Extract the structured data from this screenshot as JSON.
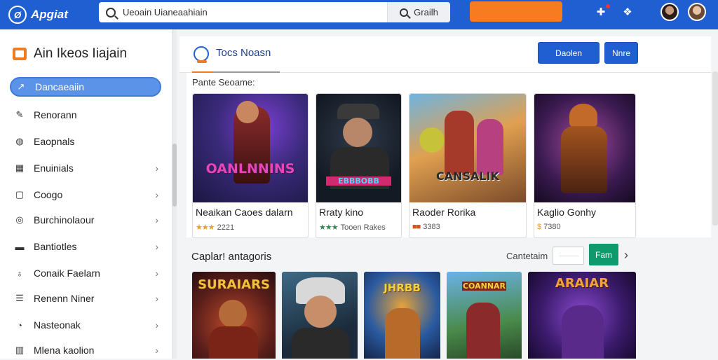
{
  "topbar": {
    "logo_text": "Apgiat",
    "search_value": "Ueoain Uianeaahiain",
    "search_button": "Grailh"
  },
  "sidebar": {
    "header": "Ain Ikeos Iiajain",
    "items": [
      {
        "label": "Dancaeaiin",
        "icon": "compass-icon",
        "active": true,
        "chevron": false
      },
      {
        "label": "Renorann",
        "icon": "wrench-icon",
        "active": false,
        "chevron": false
      },
      {
        "label": "Eaopnals",
        "icon": "gamepad-icon",
        "active": false,
        "chevron": false
      },
      {
        "label": "Enuinials",
        "icon": "grid-icon",
        "active": false,
        "chevron": true
      },
      {
        "label": "Coogo",
        "icon": "square-icon",
        "active": false,
        "chevron": true
      },
      {
        "label": "Burchinolaour",
        "icon": "target-icon",
        "active": false,
        "chevron": true
      },
      {
        "label": "Bantiotles",
        "icon": "folder-icon",
        "active": false,
        "chevron": true
      },
      {
        "label": "Conaik Faelarn",
        "icon": "trophy-icon",
        "active": false,
        "chevron": true
      },
      {
        "label": "Renenn Niner",
        "icon": "list-icon",
        "active": false,
        "chevron": true
      },
      {
        "label": "Nasteonak",
        "icon": "clock-icon",
        "active": false,
        "chevron": true
      },
      {
        "label": "Mlena kaolion",
        "icon": "bars-icon",
        "active": false,
        "chevron": true
      }
    ]
  },
  "main": {
    "title": "Tocs Noasn",
    "button_primary": "Daolen",
    "button_secondary": "Nnre",
    "section_label": "Pante Seoame:",
    "popular": [
      {
        "title": "Neaikan Caoes dalarn",
        "meta": "2221",
        "image_text": "OANLNNINS"
      },
      {
        "title": "Rraty kino",
        "meta": "Tooen Rakes",
        "image_text": "EBBBOBB"
      },
      {
        "title": "Raoder Rorika",
        "meta": "3383",
        "image_text": "CANSALIK"
      },
      {
        "title": "Kaglio Gonhy",
        "meta": "7380",
        "image_text": ""
      }
    ],
    "categories": {
      "title": "Caplar! antagoris",
      "caption": "Cantetaim",
      "button": "Fam",
      "tiles": [
        {
          "image_text": "SURAIARS"
        },
        {
          "image_text": ""
        },
        {
          "image_text": "JHRBB"
        },
        {
          "image_text": "COANNAR"
        },
        {
          "image_text": "ARAIAR"
        }
      ]
    }
  },
  "colors": {
    "topbar": "#1f5fd1",
    "accent_orange": "#f67c1f",
    "active_nav": "#5b93e8",
    "green_button": "#0f9a6b"
  }
}
